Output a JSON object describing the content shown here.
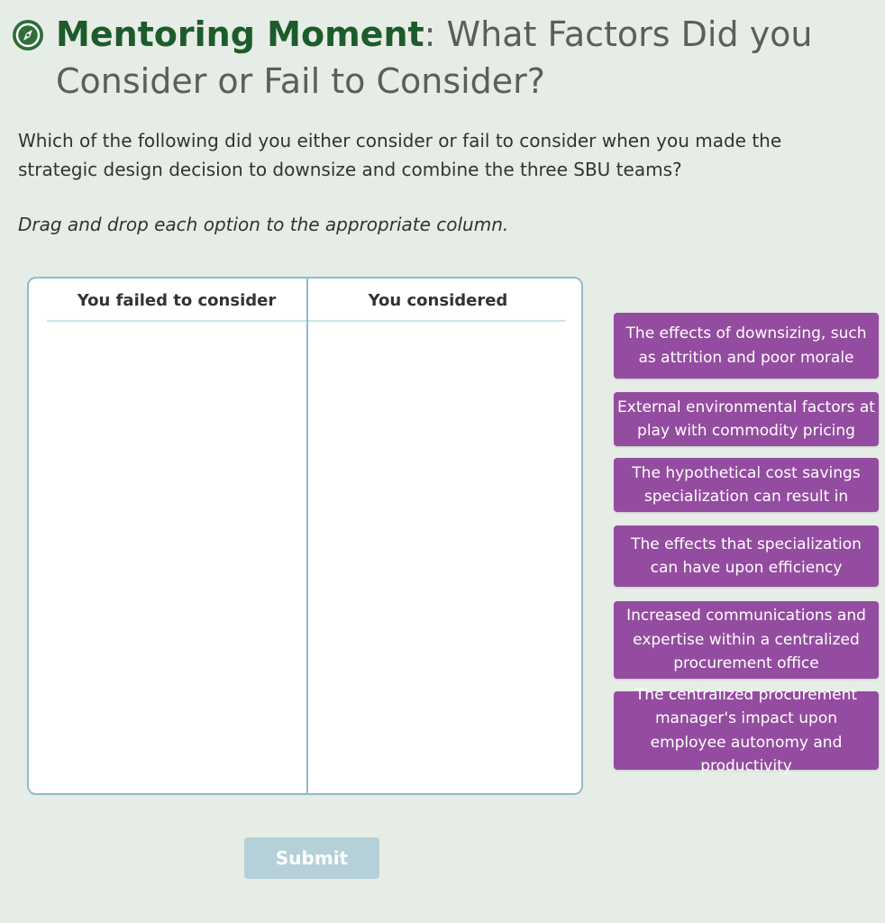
{
  "header": {
    "title_strong": "Mentoring Moment",
    "title_rest": ": What Factors Did you Consider or Fail to Consider?",
    "icon": "compass-icon"
  },
  "intro_text": "Which of the following did you either consider or fail to consider when you made the strategic design decision to downsize and combine the three SBU teams?",
  "instruction_text": "Drag and drop each option to the appropriate column.",
  "columns": [
    {
      "label": "You failed to consider"
    },
    {
      "label": "You considered"
    }
  ],
  "options": [
    {
      "label": "The effects of downsizing, such as attrition and poor morale"
    },
    {
      "label": "External environmental factors at play with commodity pricing"
    },
    {
      "label": "The hypothetical cost savings specialization can result in"
    },
    {
      "label": "The effects that specialization can have upon efficiency"
    },
    {
      "label": "Increased communications and expertise within a centralized procurement office"
    },
    {
      "label": "The centralized procurement manager's impact upon employee autonomy and productivity"
    }
  ],
  "submit_label": "Submit",
  "colors": {
    "title_green": "#1e5b2a",
    "card_purple": "#944ca0",
    "board_border": "#8fbccb",
    "submit_disabled": "#b5d0d9",
    "background": "#e6ece6"
  }
}
